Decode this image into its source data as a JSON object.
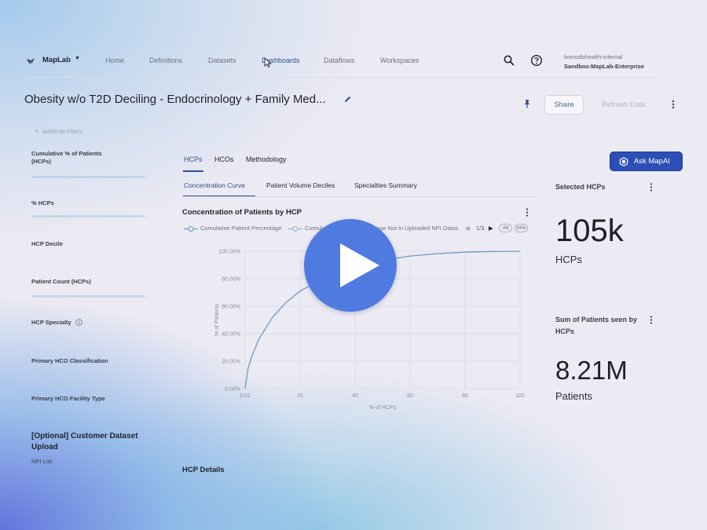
{
  "nav": {
    "brand": "MapLab",
    "links": [
      "Home",
      "Definitions",
      "Datasets",
      "Dashboards",
      "Dataflows",
      "Workspaces"
    ],
    "icons": [
      "search-icon",
      "help-icon"
    ],
    "org_top": "komodohealth-internal",
    "org_bottom": "Sandbox-MapLab-Enterprise"
  },
  "header": {
    "title": "Obesity w/o T2D Deciling - Endocrinology + Family Med...",
    "share_label": "Share",
    "refresh_label": "Refresh Data"
  },
  "filters": {
    "add_label": "Add/Edit Filters",
    "items": [
      "Cumulative % of Patients (HCPs)",
      "% HCPs",
      "HCP Decile",
      "Patient Count (HCPs)",
      "HCP Specialty",
      "Primary HCO Classification",
      "Primary HCO Facility Type"
    ],
    "upload_title": "[Optional] Customer Dataset Upload",
    "npi_label": "NPI List"
  },
  "tabs": {
    "primary": [
      "HCPs",
      "HCOs",
      "Methodology"
    ],
    "secondary": [
      "Concentration Curve",
      "Patient Volume Deciles",
      "Specialties Summary"
    ]
  },
  "ask_button": "Ask MapAI",
  "chart": {
    "title": "Concentration of Patients by HCP",
    "legend": [
      "Cumulative Patient Percentage",
      "Cumulative Patient Percentage Not in Uploaded NPI Datas"
    ],
    "pager": "1/3",
    "pill_all": "All",
    "pill_pct": "In%"
  },
  "chart_data": {
    "type": "line",
    "title": "Concentration of Patients by HCP",
    "xlabel": "% of HCPs",
    "ylabel": "% of Patients",
    "x_ticks": [
      "0.01",
      "20",
      "40",
      "60",
      "80",
      "100"
    ],
    "y_ticks": [
      "0.00%",
      "20.00%",
      "40.00%",
      "60.00%",
      "80.00%",
      "100.00%"
    ],
    "xlim": [
      0,
      100
    ],
    "ylim": [
      0,
      100
    ],
    "grid": true,
    "series": [
      {
        "name": "Cumulative Patient Percentage",
        "color": "#6a9cc4",
        "x": [
          0.01,
          1,
          2.5,
          5,
          10,
          15,
          20,
          30,
          40,
          50,
          60,
          70,
          80,
          90,
          100
        ],
        "y": [
          0,
          14,
          24,
          36,
          52,
          63,
          71,
          82,
          89,
          93.5,
          96.5,
          98.3,
          99.3,
          99.8,
          100
        ]
      }
    ]
  },
  "metrics": [
    {
      "label": "Selected HCPs",
      "value": "105k",
      "unit": "HCPs"
    },
    {
      "label": "Sum of Patients seen by HCPs",
      "value": "8.21M",
      "unit": "Patients"
    }
  ],
  "details_title": "HCP Details",
  "colors": {
    "accent": "#2c4fb5",
    "tab_active": "#2e4f8a",
    "play": "#4f7be0",
    "line": "#6a9cc4"
  }
}
